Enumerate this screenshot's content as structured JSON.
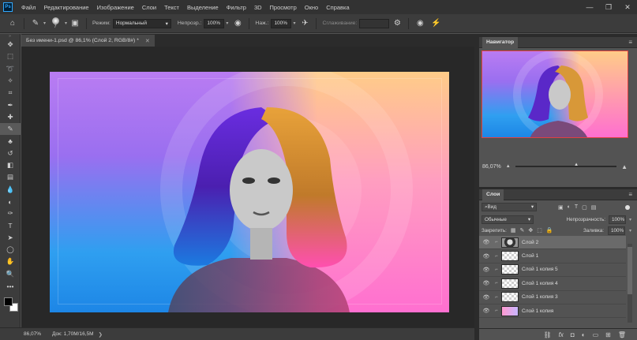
{
  "app": {
    "logo": "Ps",
    "accent": "#31a8ff"
  },
  "menu": [
    "Файл",
    "Редактирование",
    "Изображение",
    "Слои",
    "Текст",
    "Выделение",
    "Фильтр",
    "3D",
    "Просмотр",
    "Окно",
    "Справка"
  ],
  "options": {
    "brush_size": "7",
    "mode_label": "Режим:",
    "mode_value": "Нормальный",
    "opacity_label": "Непрозр.:",
    "opacity_value": "100%",
    "pressure_label": "Наж.:",
    "pressure_value": "100%",
    "smoothing_label": "Сглаживание:"
  },
  "document": {
    "tab_title": "Без имени-1.psd @ 86,1% (Слой 2, RGB/8#) *"
  },
  "status": {
    "zoom": "86,07%",
    "doc_info": "Док: 1,70M/16,5M"
  },
  "navigator": {
    "title": "Навигатор",
    "zoom": "86,07%"
  },
  "layers": {
    "title": "Слои",
    "filter_kind": "Вид",
    "blend_mode": "Обычные",
    "opacity_label": "Непрозрачность:",
    "opacity_value": "100%",
    "lock_label": "Закрепить:",
    "fill_label": "Заливка:",
    "fill_value": "100%",
    "items": [
      {
        "name": "Слой 2",
        "thumb": "face",
        "selected": true
      },
      {
        "name": "Слой 1",
        "thumb": "checker",
        "selected": false
      },
      {
        "name": "Слой 1 копия 5",
        "thumb": "checker",
        "selected": false
      },
      {
        "name": "Слой 1 копия 4",
        "thumb": "checker",
        "selected": false
      },
      {
        "name": "Слой 1 копия 3",
        "thumb": "checker",
        "selected": false
      },
      {
        "name": "Слой 1 копия",
        "thumb": "pic",
        "selected": false
      }
    ]
  },
  "icons": {
    "tools": [
      "move-icon",
      "marquee-icon",
      "lasso-icon",
      "magic-wand-icon",
      "crop-icon",
      "eyedropper-icon",
      "healing-icon",
      "brush-icon",
      "stamp-icon",
      "history-brush-icon",
      "eraser-icon",
      "gradient-icon",
      "blur-icon",
      "dodge-icon",
      "pen-icon",
      "type-icon",
      "path-select-icon",
      "shape-icon",
      "hand-icon",
      "zoom-icon",
      "more-icon"
    ],
    "layer_panel_bottom": [
      "link-icon",
      "fx-icon",
      "mask-icon",
      "adjustment-icon",
      "group-icon",
      "new-layer-icon",
      "trash-icon"
    ]
  }
}
